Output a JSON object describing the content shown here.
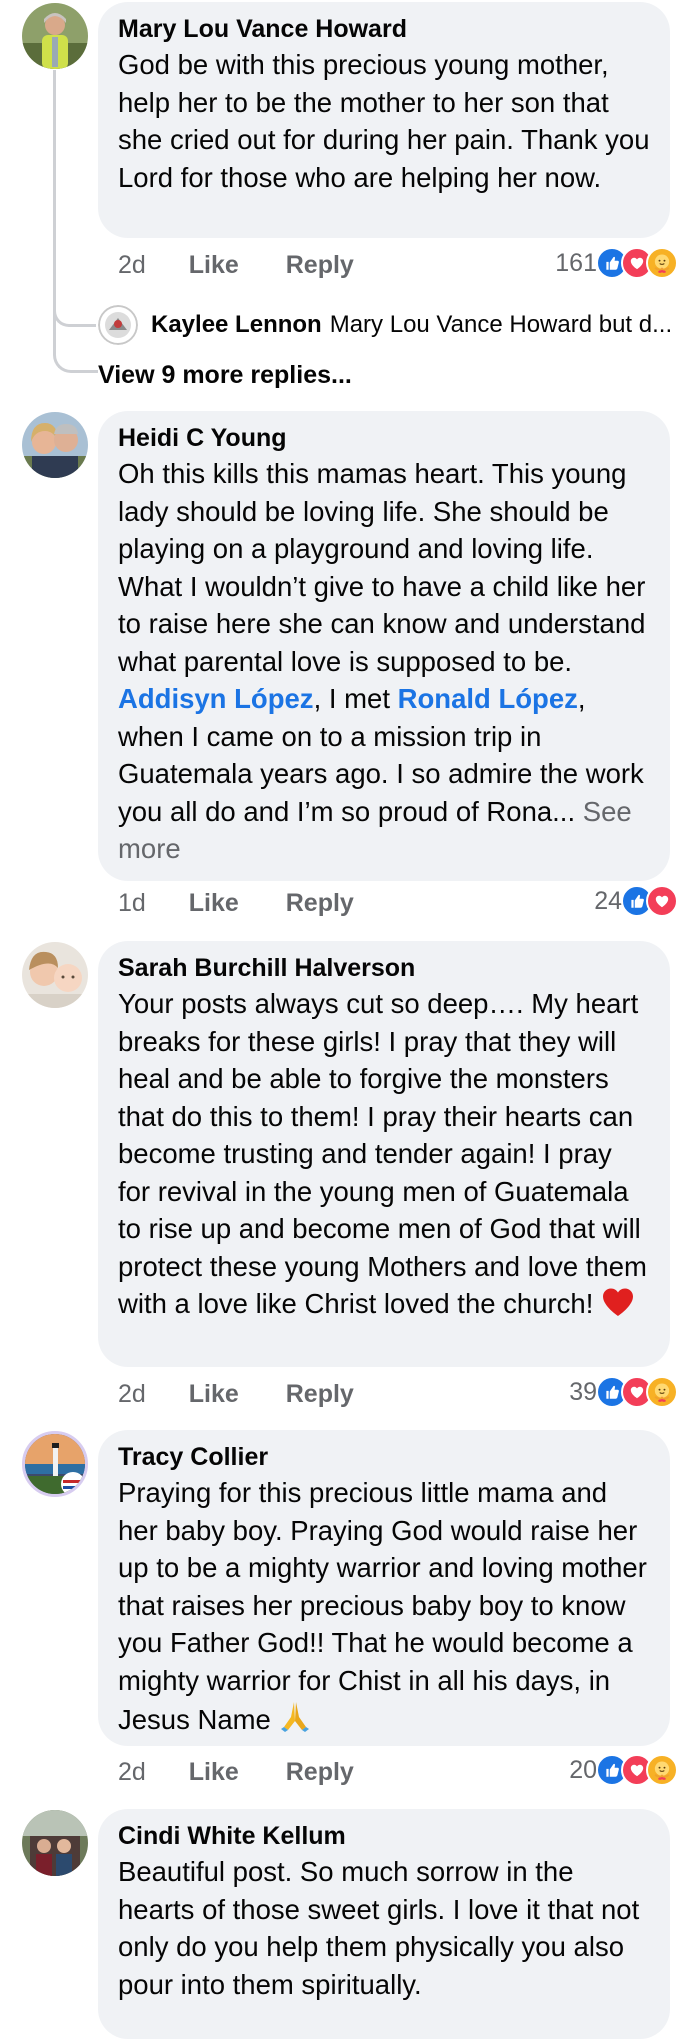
{
  "comments": [
    {
      "author": "Mary Lou Vance Howard",
      "text": "God be with this precious young mother, help her to be the mother to her son that she cried out for during her pain.   Thank you Lord for those who are helping her now.",
      "time": "2d",
      "like_label": "Like",
      "reply_label": "Reply",
      "reaction_count": "161",
      "reactions": [
        "like-icon",
        "love-icon",
        "care-icon"
      ],
      "reply_preview": {
        "author": "Kaylee Lennon",
        "snippet": "Mary Lou Vance Howard but d..."
      },
      "view_more_replies": "View 9 more replies..."
    },
    {
      "author": "Heidi C Young",
      "text_before": "Oh this kills this mamas heart. This young lady should be loving life. She should be playing on a playground and loving life. What I wouldn’t give to have a child like her to raise here she can know and understand what parental love is supposed to be. ",
      "mention_1": "Addisyn López",
      "text_middle": ", I met ",
      "mention_2": "Ronald López",
      "text_after": ", when I came on to a mission trip in Guatemala years ago. I so admire the work you all do and I’m so proud of Rona... ",
      "see_more": "See more",
      "time": "1d",
      "like_label": "Like",
      "reply_label": "Reply",
      "reaction_count": "24",
      "reactions": [
        "like-icon",
        "love-icon"
      ]
    },
    {
      "author": "Sarah Burchill Halverson",
      "text": "Your posts always cut so deep…. My heart breaks for these girls! I pray that they will heal and be able to forgive the monsters that do this to them! I pray their hearts can become trusting and tender again! I pray for revival in the young men of Guatemala to rise up and become men of God that will protect these young Mothers and love them with a love like Christ loved the church! ",
      "emoji": "heart-emoji",
      "time": "2d",
      "like_label": "Like",
      "reply_label": "Reply",
      "reaction_count": "39",
      "reactions": [
        "like-icon",
        "love-icon",
        "care-icon"
      ]
    },
    {
      "author": "Tracy Collier",
      "text": "Praying for this precious little mama and her baby boy. Praying God would raise her up to be a mighty warrior and loving mother that raises her precious baby boy to know you Father God!! That he would become a mighty warrior for Chist in all his days, in Jesus Name ",
      "emoji": "praying-hands-emoji",
      "time": "2d",
      "like_label": "Like",
      "reply_label": "Reply",
      "reaction_count": "20",
      "reactions": [
        "like-icon",
        "love-icon",
        "care-icon"
      ]
    },
    {
      "author": "Cindi White Kellum",
      "text": "Beautiful post. So much sorrow in the hearts of those sweet girls. I love it that not only do you help them physically you also pour into them spiritually."
    }
  ],
  "colors": {
    "bubble": "#f0f2f5",
    "secondary_text": "#65676b",
    "mention": "#1b74e4",
    "like": "#1b74e4",
    "love": "#f33e58",
    "care": "#f7b125"
  }
}
